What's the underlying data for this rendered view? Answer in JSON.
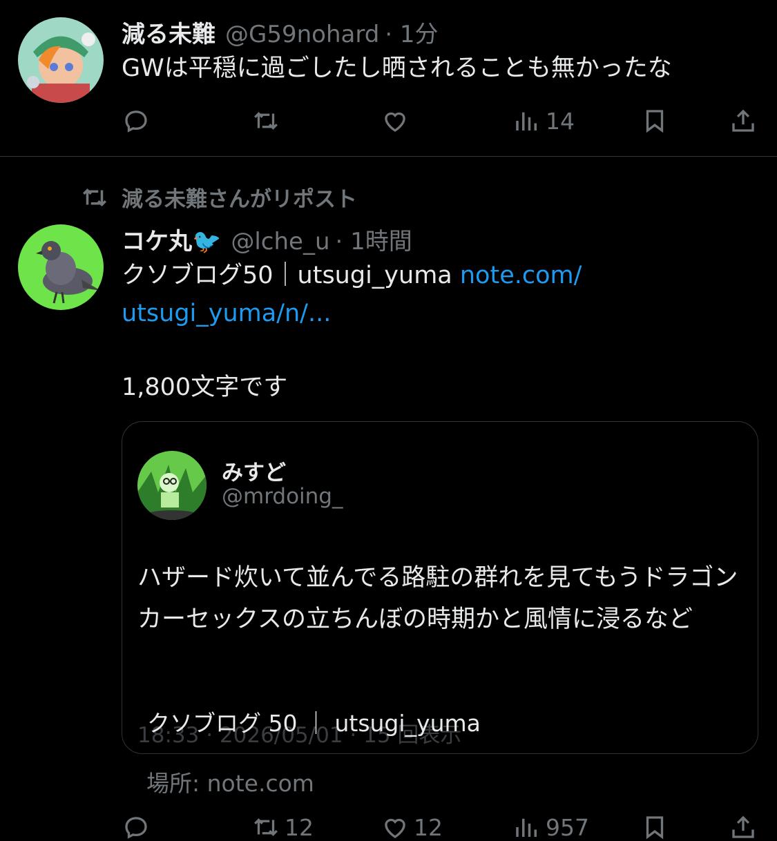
{
  "tweet1": {
    "name": "減る未難",
    "handle": "@G59nohard",
    "time": "· 1分",
    "text": "GWは平穏に過ごしたし晒されることも無かったな",
    "views": "14"
  },
  "repost_label": "減る未難さんがリポスト",
  "tweet2": {
    "name": "コケ丸🐦",
    "handle": "@lche_u",
    "time": "· 1時間",
    "text_line1": "クソブログ50｜utsugi_yuma ",
    "link_part1": "note.com/",
    "link_part2": "utsugi_yuma/n/...",
    "text_line2": "1,800文字です",
    "quote": {
      "name": "みすど",
      "handle": "@mrdoing_",
      "text": "ハザード炊いて並んでる路駐の群れを見てもうドラゴンカーセックスの立ちんぼの時期かと風情に浸るなど",
      "footer": "18:33 · 2026/05/01 · 15 回表示",
      "card_title": "クソブログ 50 ｜ utsugi_yuma"
    },
    "location": "場所: note.com",
    "retweets": "12",
    "likes": "12",
    "views": "957"
  },
  "colors": {
    "bg": "#000000",
    "text": "#e7e9ea",
    "muted": "#71767b",
    "link": "#1d9bf0",
    "border": "#2f3336"
  }
}
